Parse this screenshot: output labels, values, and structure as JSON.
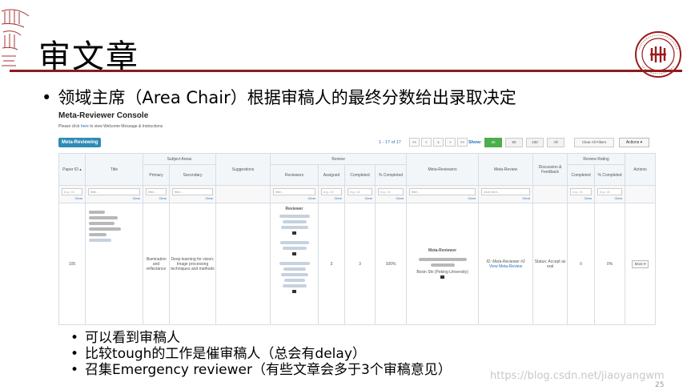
{
  "slide": {
    "title": "审文章",
    "main_bullet": "领域主席（Area Chair）根据审稿人的最终分数给出录取决定",
    "bullets": [
      "可以看到审稿人",
      "比较tough的工作是催审稿人（总会有delay）",
      "召集Emergency reviewer（有些文章会多于3个审稿意见）"
    ],
    "bullet_glyph": "•",
    "watermark": "https://blog.csdn.net/jiaoyangwm",
    "page_number": "25",
    "accent_color": "#8b1c1c"
  },
  "console": {
    "title": "Meta-Reviewer Console",
    "instruction_prefix": "Please click ",
    "instruction_link": "here",
    "instruction_suffix": " to view Welcome Message & Instructions",
    "active_tab": "Meta-Reviewing",
    "record_count": "1 - 17 of 17",
    "pager": [
      "<<",
      "<",
      "1",
      ">",
      ">>"
    ],
    "show_label": "Show:",
    "show_options": [
      "25",
      "50",
      "100",
      "All"
    ],
    "show_selected": "25",
    "clear_filters": "Clear All Filters",
    "actions_label": "Actions ▾",
    "headers": {
      "paper_id": "Paper ID ▴",
      "title": "Title",
      "subject_areas": "Subject Areas",
      "primary": "Primary",
      "secondary": "Secondary",
      "suggestions": "Suggestions",
      "review": "Review",
      "reviewers": "Reviewers",
      "assigned": "Assigned",
      "completed": "Completed",
      "pct_completed": "% Completed",
      "meta_reviewers": "Meta-Reviewers",
      "meta_review": "Meta-Review",
      "discussion": "Discussion & Feedback",
      "review_rating": "Review Rating",
      "rating_completed": "Completed",
      "rating_pct": "% Completed",
      "actions": "Actions"
    },
    "filters": {
      "eg": "e.g. <3",
      "text": "filter...",
      "click": "click here...",
      "clear": "Clear"
    },
    "row": {
      "paper_id": "105",
      "primary": "Illumination and reflectance",
      "secondary": "Deep learning for vision; Image processing techniques and methods",
      "reviewer_heading": "Reviewer",
      "assigned": "3",
      "completed": "3",
      "pct_completed": "100%",
      "meta_reviewer_heading": "Meta-Reviewer",
      "meta_reviewer_name": "Boxin Shi (Peking University)",
      "meta_review_id": "ID: Meta-Reviewer #2",
      "view_meta_review": "View Meta-Review",
      "discussion": "Status: Accept as oral",
      "rating_completed": "0",
      "rating_pct": "0%",
      "more": "More ▾"
    }
  }
}
